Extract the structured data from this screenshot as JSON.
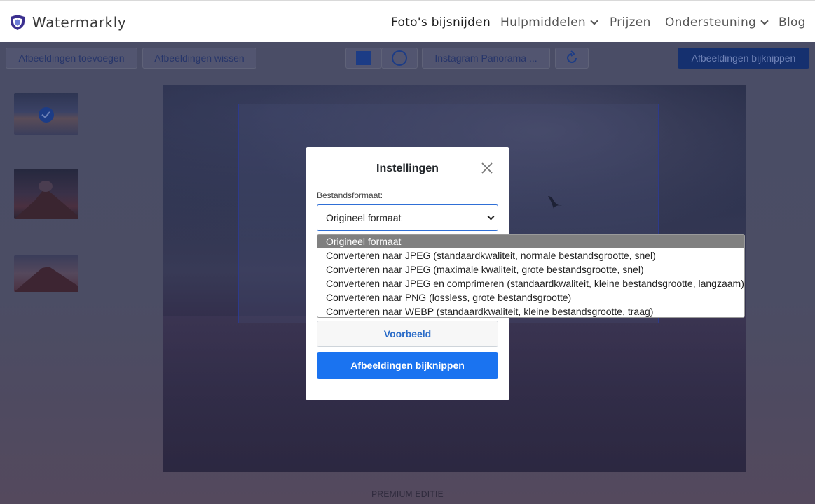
{
  "header": {
    "brand": "Watermarkly",
    "nav": [
      {
        "label": "Foto's bijsnijden",
        "active": true
      },
      {
        "label": "Hulpmiddelen",
        "dropdown": true
      },
      {
        "label": "Prijzen"
      },
      {
        "label": "Ondersteuning",
        "dropdown": true
      },
      {
        "label": "Blog"
      }
    ]
  },
  "toolbar": {
    "add_images": "Afbeeldingen toevoegen",
    "clear_images": "Afbeeldingen wissen",
    "aspect_preset": "Instagram Panorama ...",
    "crop_images": "Afbeeldingen bijknippen"
  },
  "footer": {
    "edition": "PREMIUM EDITIE"
  },
  "modal": {
    "title": "Instellingen",
    "format_label": "Bestandsformaat:",
    "format_value": "Origineel formaat",
    "options": [
      "Origineel formaat",
      "Converteren naar JPEG (standaardkwaliteit, normale bestandsgrootte, snel)",
      "Converteren naar JPEG (maximale kwaliteit, grote bestandsgrootte, snel)",
      "Converteren naar JPEG en comprimeren (standaardkwaliteit, kleine bestandsgrootte, langzaam)",
      "Converteren naar PNG (lossless, grote bestandsgrootte)",
      "Converteren naar WEBP (standaardkwaliteit, kleine bestandsgrootte, traag)"
    ],
    "preview_button": "Voorbeeld",
    "crop_button": "Afbeeldingen bijknippen"
  },
  "colors": {
    "primary": "#1a73f0",
    "overlay": "#4a4d66",
    "brand_shield": "#3b2f8f"
  }
}
